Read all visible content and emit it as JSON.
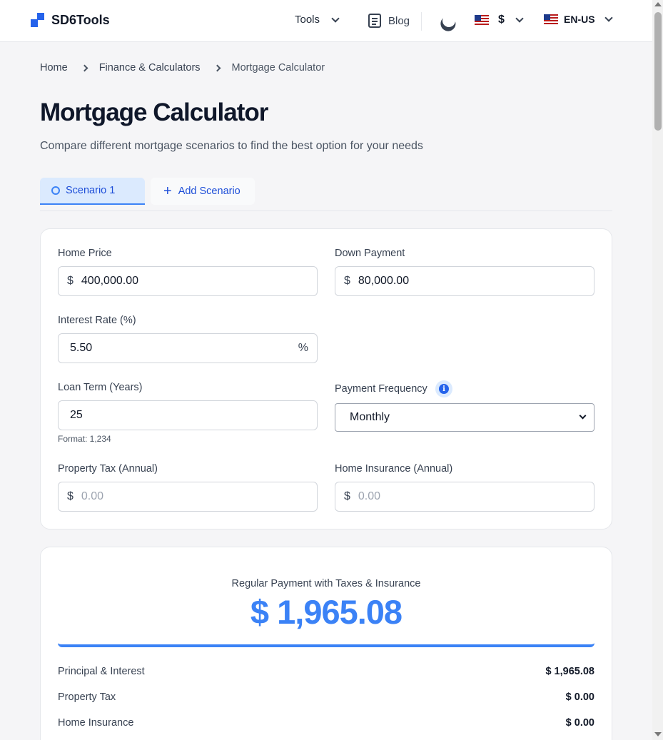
{
  "brand": {
    "name": "SD6Tools"
  },
  "nav": {
    "tools_label": "Tools",
    "blog_label": "Blog",
    "currency_symbol": "$",
    "language": "EN-US"
  },
  "breadcrumb": [
    "Home",
    "Finance & Calculators",
    "Mortgage Calculator"
  ],
  "page": {
    "title": "Mortgage Calculator",
    "subtitle": "Compare different mortgage scenarios to find the best option for your needs"
  },
  "tabs": {
    "active": "Scenario 1",
    "add": "Add Scenario"
  },
  "form": {
    "home_price": {
      "label": "Home Price",
      "prefix": "$",
      "value": "400,000.00"
    },
    "down_payment": {
      "label": "Down Payment",
      "prefix": "$",
      "value": "80,000.00"
    },
    "interest_rate": {
      "label": "Interest Rate (%)",
      "value": "5.50",
      "suffix": "%"
    },
    "loan_term": {
      "label": "Loan Term (Years)",
      "value": "25",
      "hint": "Format: 1,234"
    },
    "payment_frequency": {
      "label": "Payment Frequency",
      "value": "Monthly"
    },
    "property_tax": {
      "label": "Property Tax (Annual)",
      "prefix": "$",
      "placeholder": "0.00"
    },
    "home_insurance": {
      "label": "Home Insurance (Annual)",
      "prefix": "$",
      "placeholder": "0.00"
    }
  },
  "result": {
    "label": "Regular Payment with Taxes & Insurance",
    "amount": "$ 1,965.08",
    "rows": [
      {
        "label": "Principal & Interest",
        "value": "$ 1,965.08"
      },
      {
        "label": "Property Tax",
        "value": "$ 0.00"
      },
      {
        "label": "Home Insurance",
        "value": "$ 0.00"
      }
    ]
  },
  "colors": {
    "accent": "#3b82f6",
    "brand": "#2563eb"
  }
}
